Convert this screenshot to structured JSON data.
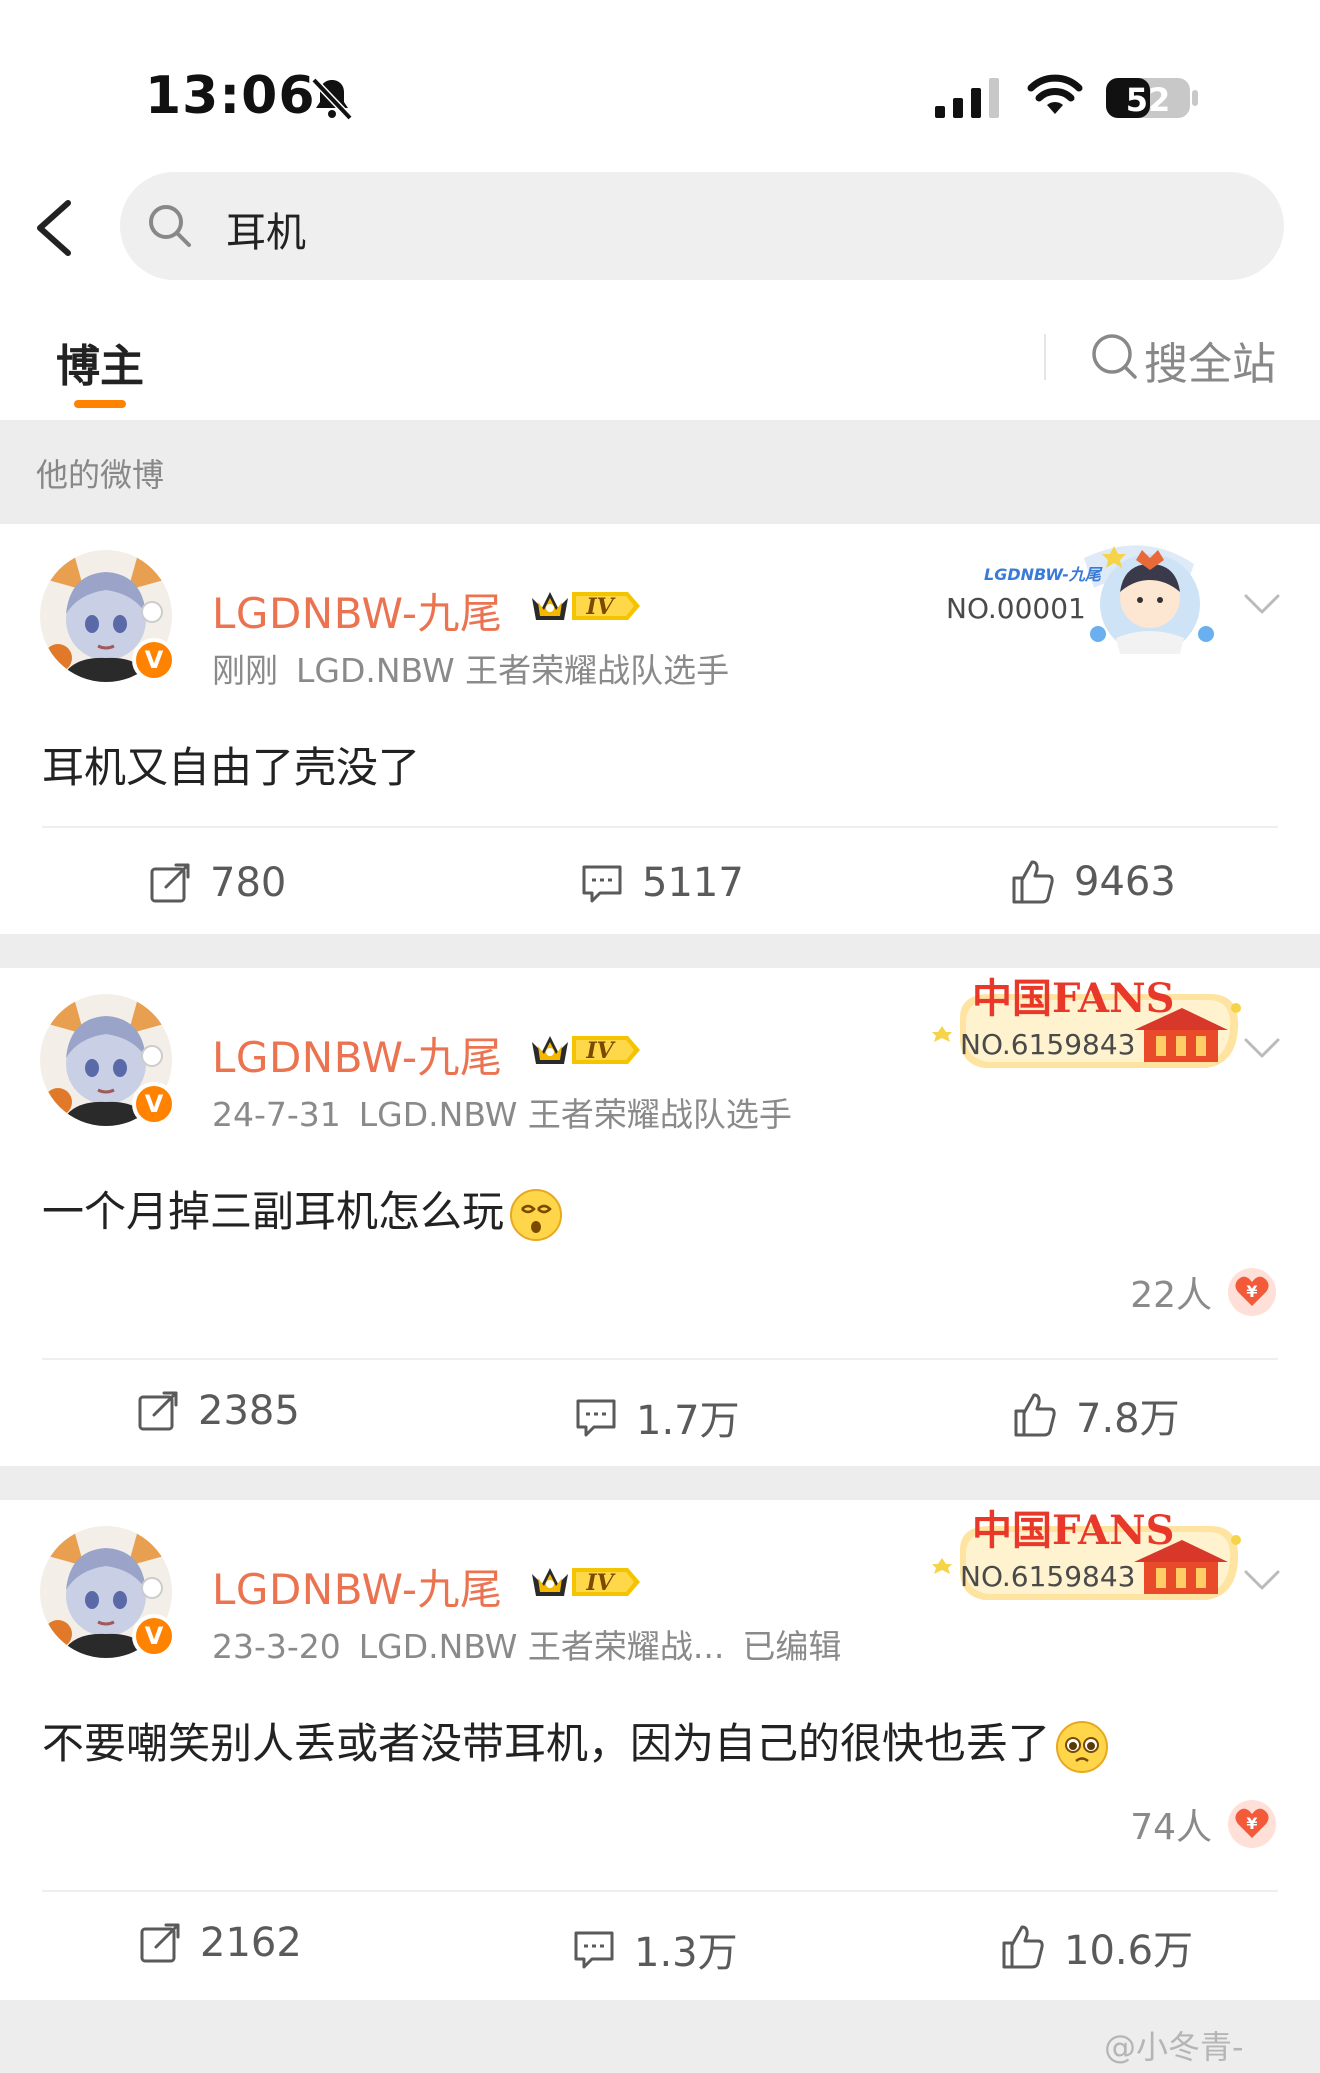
{
  "status_bar": {
    "time": "13:06",
    "battery": "52"
  },
  "search": {
    "query": "耳机"
  },
  "tabs": {
    "blogger": "博主",
    "search_all": "搜全站"
  },
  "section_label": "他的微博",
  "posts": [
    {
      "username": "LGDNBW-九尾",
      "level": "IV",
      "time": "刚刚",
      "source": "LGD.NBW 王者荣耀战队选手",
      "edited": "",
      "badge_text": "NO.00001",
      "badge_label": "LGDNBW-九尾",
      "text": "耳机又自由了壳没了",
      "reward": "",
      "reposts": "780",
      "comments": "5117",
      "likes": "9463"
    },
    {
      "username": "LGDNBW-九尾",
      "level": "IV",
      "time": "24-7-31",
      "source": "LGD.NBW 王者荣耀战队选手",
      "edited": "",
      "badge_text": "NO.6159843",
      "badge_label": "中国FANS",
      "text": "一个月掉三副耳机怎么玩",
      "reward": "22人",
      "reposts": "2385",
      "comments": "1.7万",
      "likes": "7.8万"
    },
    {
      "username": "LGDNBW-九尾",
      "level": "IV",
      "time": "23-3-20",
      "source": "LGD.NBW 王者荣耀战...",
      "edited": "已编辑",
      "badge_text": "NO.6159843",
      "badge_label": "中国FANS",
      "text": "不要嘲笑别人丢或者没带耳机，因为自己的很快也丢了",
      "reward": "74人",
      "reposts": "2162",
      "comments": "1.3万",
      "likes": "10.6万"
    }
  ],
  "watermark": "@小冬青-",
  "colors": {
    "accent": "#ff8200",
    "username": "#eb7350",
    "background": "#ededed"
  }
}
